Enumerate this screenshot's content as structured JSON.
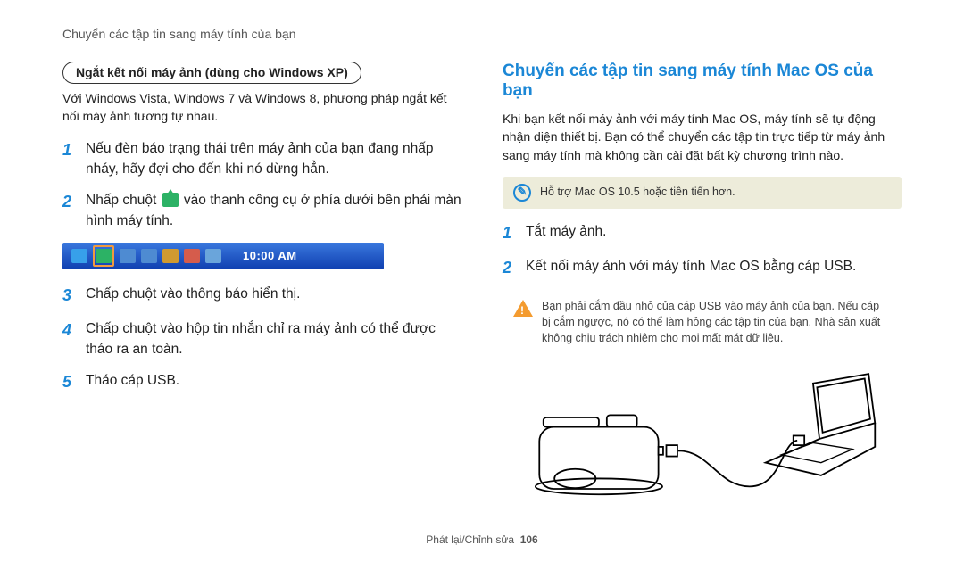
{
  "breadcrumb": "Chuyển các tập tin sang máy tính của bạn",
  "left": {
    "pill": "Ngắt kết nối máy ảnh (dùng cho Windows XP)",
    "intro": "Với Windows Vista, Windows 7 và Windows 8, phương pháp ngắt kết nối máy ảnh tương tự nhau.",
    "steps": [
      "Nếu đèn báo trạng thái trên máy ảnh của bạn đang nhấp nháy, hãy đợi cho đến khi nó dừng hẳn.",
      "Nhấp chuột  vào thanh công cụ ở phía dưới bên phải màn hình máy tính.",
      "Chấp chuột vào thông báo hiển thị.",
      "Chấp chuột vào hộp tin nhắn chỉ ra máy ảnh có thể được tháo ra an toàn.",
      "Tháo cáp USB."
    ],
    "taskbar_time": "10:00 AM"
  },
  "right": {
    "heading": "Chuyển các tập tin sang máy tính Mac OS của bạn",
    "intro": "Khi bạn kết nối máy ảnh với máy tính Mac OS, máy tính sẽ tự động nhận diện thiết bị. Bạn có thể chuyển các tập tin trực tiếp từ máy ảnh sang máy tính mà không cần cài đặt bất kỳ chương trình nào.",
    "note": "Hỗ trợ Mac OS 10.5 hoặc tiên tiến hơn.",
    "steps": [
      "Tắt máy ảnh.",
      "Kết nối máy ảnh với máy tính Mac OS bằng cáp USB."
    ],
    "warn": "Bạn phải cắm đầu nhỏ của cáp USB vào máy ảnh của bạn. Nếu cáp bị cắm ngược, nó có thể làm hỏng các tập tin của bạn. Nhà sản xuất không chịu trách nhiệm cho mọi mất mát dữ liệu."
  },
  "footer": {
    "section": "Phát lại/Chỉnh sửa",
    "page": "106"
  }
}
